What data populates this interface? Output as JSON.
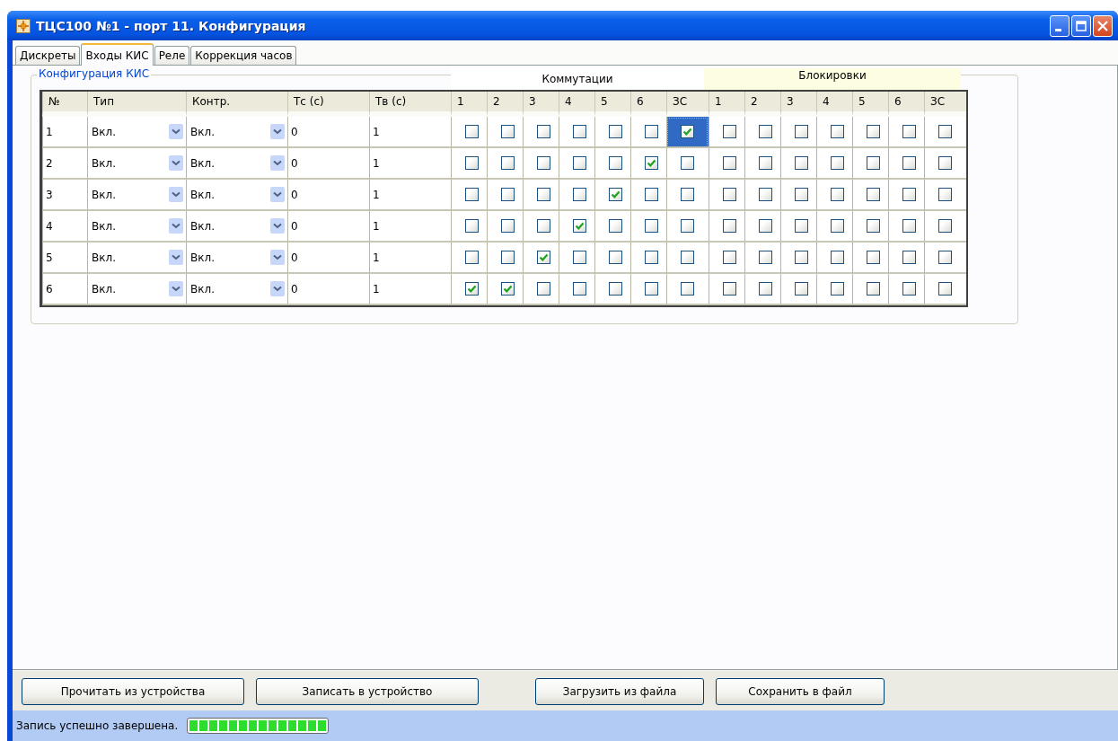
{
  "window": {
    "title": "ТЦС100 №1 - порт 11. Конфигурация"
  },
  "tabs": [
    {
      "label": "Дискреты",
      "selected": false
    },
    {
      "label": "Входы КИС",
      "selected": true
    },
    {
      "label": "Реле",
      "selected": false
    },
    {
      "label": "Коррекция часов",
      "selected": false
    }
  ],
  "group": {
    "title": "Конфигурация КИС",
    "section_headers": [
      "Коммутации",
      "Блокировки"
    ]
  },
  "table": {
    "columns": [
      "№",
      "Тип",
      "Контр.",
      "Тс (с)",
      "Тв (с)",
      "1",
      "2",
      "3",
      "4",
      "5",
      "6",
      "ЗС",
      "1",
      "2",
      "3",
      "4",
      "5",
      "6",
      "ЗС"
    ],
    "rows": [
      {
        "number": "1",
        "type": "Вкл.",
        "control": "Вкл.",
        "tc": "0",
        "tv": "1",
        "switching": [
          {
            "checked": false,
            "selected": false
          },
          {
            "checked": false,
            "selected": false
          },
          {
            "checked": false,
            "selected": false
          },
          {
            "checked": false,
            "selected": false
          },
          {
            "checked": false,
            "selected": false
          },
          {
            "checked": false,
            "selected": false
          },
          {
            "checked": true,
            "selected": true
          }
        ],
        "blocking": [
          {
            "checked": false,
            "selected": false
          },
          {
            "checked": false,
            "selected": false
          },
          {
            "checked": false,
            "selected": false
          },
          {
            "checked": false,
            "selected": false
          },
          {
            "checked": false,
            "selected": false
          },
          {
            "checked": false,
            "selected": false
          },
          {
            "checked": false,
            "selected": false
          }
        ]
      },
      {
        "number": "2",
        "type": "Вкл.",
        "control": "Вкл.",
        "tc": "0",
        "tv": "1",
        "switching": [
          {
            "checked": false,
            "selected": false
          },
          {
            "checked": false,
            "selected": false
          },
          {
            "checked": false,
            "selected": false
          },
          {
            "checked": false,
            "selected": false
          },
          {
            "checked": false,
            "selected": false
          },
          {
            "checked": true,
            "selected": false
          },
          {
            "checked": false,
            "selected": false
          }
        ],
        "blocking": [
          {
            "checked": false,
            "selected": false
          },
          {
            "checked": false,
            "selected": false
          },
          {
            "checked": false,
            "selected": false
          },
          {
            "checked": false,
            "selected": false
          },
          {
            "checked": false,
            "selected": false
          },
          {
            "checked": false,
            "selected": false
          },
          {
            "checked": false,
            "selected": false
          }
        ]
      },
      {
        "number": "3",
        "type": "Вкл.",
        "control": "Вкл.",
        "tc": "0",
        "tv": "1",
        "switching": [
          {
            "checked": false,
            "selected": false
          },
          {
            "checked": false,
            "selected": false
          },
          {
            "checked": false,
            "selected": false
          },
          {
            "checked": false,
            "selected": false
          },
          {
            "checked": true,
            "selected": false
          },
          {
            "checked": false,
            "selected": false
          },
          {
            "checked": false,
            "selected": false
          }
        ],
        "blocking": [
          {
            "checked": false,
            "selected": false
          },
          {
            "checked": false,
            "selected": false
          },
          {
            "checked": false,
            "selected": false
          },
          {
            "checked": false,
            "selected": false
          },
          {
            "checked": false,
            "selected": false
          },
          {
            "checked": false,
            "selected": false
          },
          {
            "checked": false,
            "selected": false
          }
        ]
      },
      {
        "number": "4",
        "type": "Вкл.",
        "control": "Вкл.",
        "tc": "0",
        "tv": "1",
        "switching": [
          {
            "checked": false,
            "selected": false
          },
          {
            "checked": false,
            "selected": false
          },
          {
            "checked": false,
            "selected": false
          },
          {
            "checked": true,
            "selected": false
          },
          {
            "checked": false,
            "selected": false
          },
          {
            "checked": false,
            "selected": false
          },
          {
            "checked": false,
            "selected": false
          }
        ],
        "blocking": [
          {
            "checked": false,
            "selected": false
          },
          {
            "checked": false,
            "selected": false
          },
          {
            "checked": false,
            "selected": false
          },
          {
            "checked": false,
            "selected": false
          },
          {
            "checked": false,
            "selected": false
          },
          {
            "checked": false,
            "selected": false
          },
          {
            "checked": false,
            "selected": false
          }
        ]
      },
      {
        "number": "5",
        "type": "Вкл.",
        "control": "Вкл.",
        "tc": "0",
        "tv": "1",
        "switching": [
          {
            "checked": false,
            "selected": false
          },
          {
            "checked": false,
            "selected": false
          },
          {
            "checked": true,
            "selected": false
          },
          {
            "checked": false,
            "selected": false
          },
          {
            "checked": false,
            "selected": false
          },
          {
            "checked": false,
            "selected": false
          },
          {
            "checked": false,
            "selected": false
          }
        ],
        "blocking": [
          {
            "checked": false,
            "selected": false
          },
          {
            "checked": false,
            "selected": false
          },
          {
            "checked": false,
            "selected": false
          },
          {
            "checked": false,
            "selected": false
          },
          {
            "checked": false,
            "selected": false
          },
          {
            "checked": false,
            "selected": false
          },
          {
            "checked": false,
            "selected": false
          }
        ]
      },
      {
        "number": "6",
        "type": "Вкл.",
        "control": "Вкл.",
        "tc": "0",
        "tv": "1",
        "switching": [
          {
            "checked": true,
            "selected": false
          },
          {
            "checked": true,
            "selected": false
          },
          {
            "checked": false,
            "selected": false
          },
          {
            "checked": false,
            "selected": false
          },
          {
            "checked": false,
            "selected": false
          },
          {
            "checked": false,
            "selected": false
          },
          {
            "checked": false,
            "selected": false
          }
        ],
        "blocking": [
          {
            "checked": false,
            "selected": false
          },
          {
            "checked": false,
            "selected": false
          },
          {
            "checked": false,
            "selected": false
          },
          {
            "checked": false,
            "selected": false
          },
          {
            "checked": false,
            "selected": false
          },
          {
            "checked": false,
            "selected": false
          },
          {
            "checked": false,
            "selected": false
          }
        ]
      }
    ]
  },
  "buttons": [
    "Прочитать из устройства",
    "Записать в устройство",
    "Загрузить из файла",
    "Сохранить в файл"
  ],
  "status_bar": {
    "text": "Запись успешно завершена.",
    "progress": {
      "level": 1
    }
  }
}
